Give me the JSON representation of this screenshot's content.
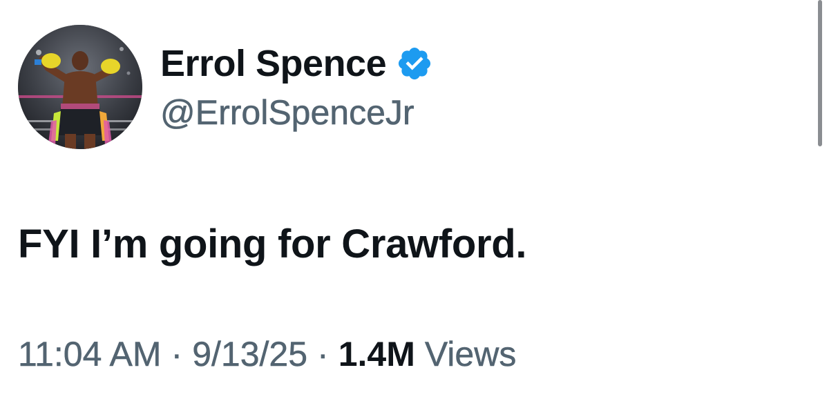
{
  "author": {
    "display_name": "Errol Spence",
    "handle": "@ErrolSpenceJr",
    "verified": true,
    "verified_color": "#1d9bf0",
    "avatar_icon": "boxer-profile-photo"
  },
  "tweet": {
    "text": "FYI I’m going for Crawford."
  },
  "meta": {
    "time": "11:04 AM",
    "separator": "·",
    "date": "9/13/25",
    "views_count": "1.4M",
    "views_label": "Views"
  },
  "colors": {
    "text_primary": "#0f1419",
    "text_secondary": "#536471",
    "background": "#ffffff"
  }
}
